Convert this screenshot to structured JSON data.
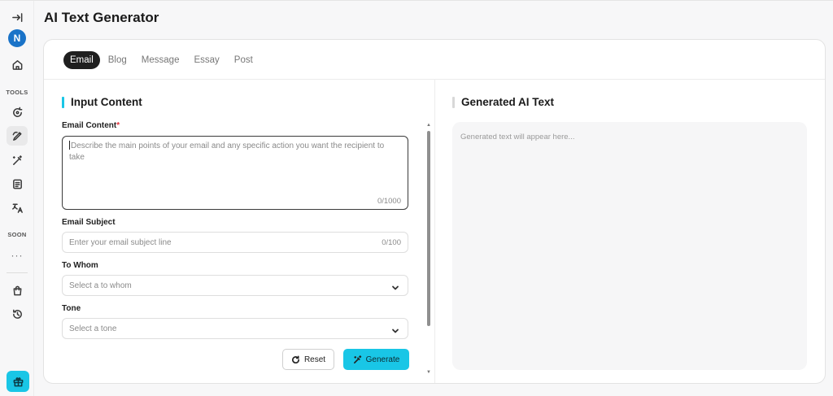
{
  "sidebar": {
    "collapse_icon": "collapse-arrow-icon",
    "avatar_letter": "N",
    "home_icon": "home-icon",
    "tools_label": "TOOLS",
    "tools": [
      {
        "icon": "rotate-refresh-icon"
      },
      {
        "icon": "pen-tool-icon",
        "active": true
      },
      {
        "icon": "magic-wand-icon"
      },
      {
        "icon": "document-text-icon"
      },
      {
        "icon": "translate-icon"
      }
    ],
    "soon_label": "SOON",
    "more_dots": "···",
    "bag_icon": "shopping-bag-icon",
    "history_icon": "history-icon",
    "gift_icon": "gift-icon",
    "accent_color": "#19c6e6"
  },
  "page": {
    "title": "AI Text Generator"
  },
  "tabs": [
    "Email",
    "Blog",
    "Message",
    "Essay",
    "Post"
  ],
  "active_tab": "Email",
  "input_section": {
    "title": "Input Content",
    "content_label": "Email Content",
    "required_mark": "*",
    "content_placeholder": "Describe the main points of your email and any specific action you want the recipient to take",
    "content_counter": "0/1000",
    "subject_label": "Email Subject",
    "subject_placeholder": "Enter your email subject line",
    "subject_counter": "0/100",
    "whom_label": "To Whom",
    "whom_placeholder": "Select a to whom",
    "tone_label": "Tone",
    "tone_placeholder": "Select a tone",
    "reset_label": "Reset",
    "generate_label": "Generate"
  },
  "output_section": {
    "title": "Generated AI Text",
    "placeholder": "Generated text will appear here..."
  }
}
